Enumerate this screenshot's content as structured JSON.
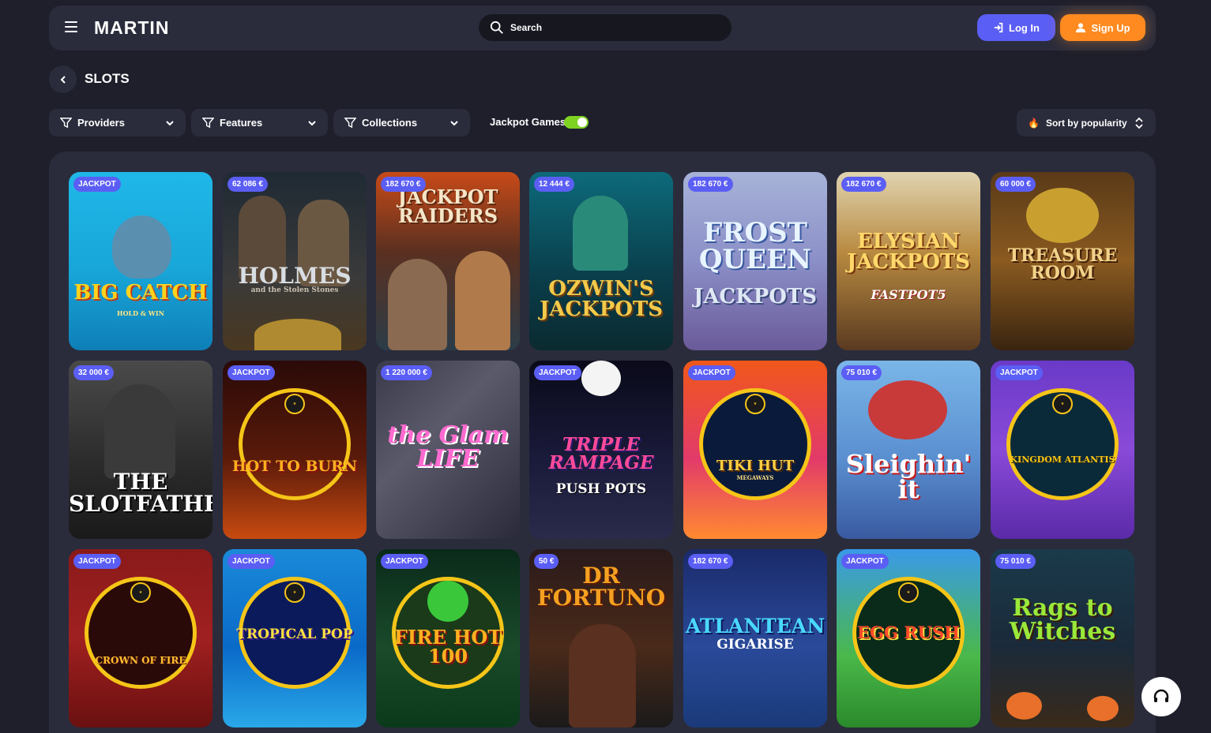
{
  "header": {
    "logo": "MARTIN",
    "search_placeholder": "Search",
    "login_label": "Log In",
    "signup_label": "Sign Up"
  },
  "page": {
    "title": "SLOTS"
  },
  "filters": {
    "providers": "Providers",
    "features": "Features",
    "collections": "Collections",
    "jackpot_toggle_label": "Jackpot Games",
    "jackpot_toggle_on": true,
    "sort_label": "Sort by popularity"
  },
  "colors": {
    "accent_blue": "#5b5ef4",
    "accent_orange": "#ff8a1f",
    "toggle_green": "#7ed321",
    "background": "#1e1f2b",
    "panel": "#2a2c3c"
  },
  "games": [
    {
      "badge": "JACKPOT",
      "title": "BIG CATCH",
      "subtitle": "HOLD & WIN"
    },
    {
      "badge": "62 086 €",
      "title": "HOLMES",
      "subtitle": "and the Stolen Stones"
    },
    {
      "badge": "182 670 €",
      "title": "JACKPOT RAIDERS",
      "subtitle": ""
    },
    {
      "badge": "12 444 €",
      "title": "OZWIN'S JACKPOTS",
      "subtitle": ""
    },
    {
      "badge": "182 670 €",
      "title": "FROST QUEEN",
      "subtitle": "JACKPOTS"
    },
    {
      "badge": "182 670 €",
      "title": "ELYSIAN JACKPOTS",
      "subtitle": "FASTPOT5"
    },
    {
      "badge": "60 000 €",
      "title": "TREASURE ROOM",
      "subtitle": ""
    },
    {
      "badge": "32 000 €",
      "title": "THE SLOTFATHER",
      "subtitle": ""
    },
    {
      "badge": "JACKPOT",
      "title": "HOT TO BURN",
      "subtitle": ""
    },
    {
      "badge": "1 220 000 €",
      "title": "the Glam LIFE",
      "subtitle": ""
    },
    {
      "badge": "JACKPOT",
      "title": "TRIPLE RAMPAGE",
      "subtitle": "PUSH POTS"
    },
    {
      "badge": "JACKPOT",
      "title": "TIKI HUT",
      "subtitle": "MEGAWAYS"
    },
    {
      "badge": "75 010 €",
      "title": "Sleighin' it",
      "subtitle": ""
    },
    {
      "badge": "JACKPOT",
      "title": "KINGDOM ATLANTIS",
      "subtitle": ""
    },
    {
      "badge": "JACKPOT",
      "title": "CROWN OF FIRE",
      "subtitle": ""
    },
    {
      "badge": "JACKPOT",
      "title": "TROPICAL POP",
      "subtitle": ""
    },
    {
      "badge": "JACKPOT",
      "title": "FIRE HOT 100",
      "subtitle": ""
    },
    {
      "badge": "50 €",
      "title": "DR FORTUNO",
      "subtitle": ""
    },
    {
      "badge": "182 670 €",
      "title": "ATLANTEAN",
      "subtitle": "GIGARISE"
    },
    {
      "badge": "JACKPOT",
      "title": "EGG RUSH",
      "subtitle": ""
    },
    {
      "badge": "75 010 €",
      "title": "Rags to Witches",
      "subtitle": ""
    }
  ],
  "chat_icon": "headset-icon"
}
